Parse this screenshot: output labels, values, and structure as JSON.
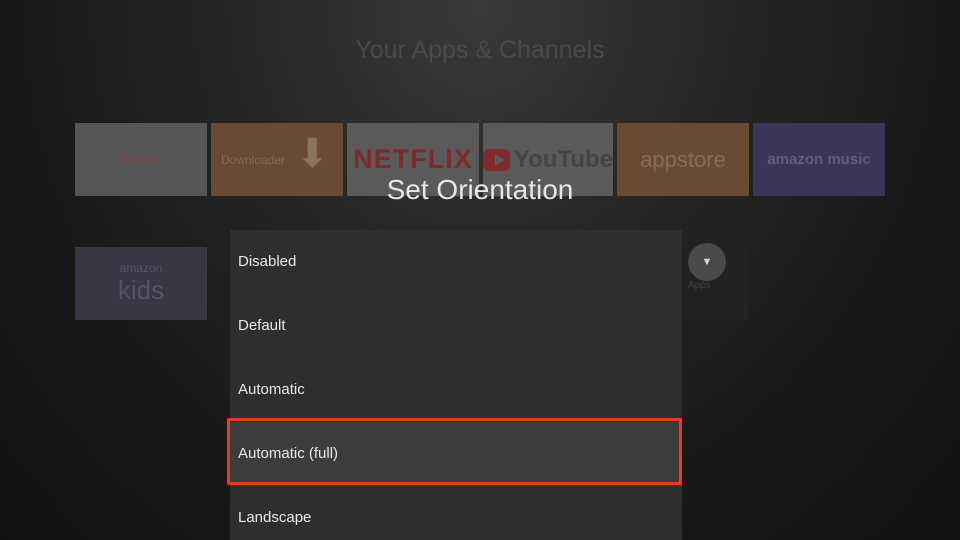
{
  "background": {
    "section_title": "Your Apps & Channels",
    "apps": [
      {
        "label": "hotstar"
      },
      {
        "label": "Downloader"
      },
      {
        "label": "NETFLIX"
      },
      {
        "label": "YouTube"
      },
      {
        "label": "appstore"
      },
      {
        "label": "amazon music"
      }
    ],
    "kids_tile": {
      "line1": "amazon",
      "line2": "kids"
    },
    "more_caption": "Apps"
  },
  "dialog": {
    "title": "Set Orientation",
    "options": [
      {
        "label": "Disabled"
      },
      {
        "label": "Default"
      },
      {
        "label": "Automatic"
      },
      {
        "label": "Automatic (full)"
      },
      {
        "label": "Landscape"
      }
    ],
    "selected_index": 3
  },
  "colors": {
    "highlight": "#e5401e",
    "panel": "#2e2e2e",
    "focused_row": "#3c3c3c"
  }
}
